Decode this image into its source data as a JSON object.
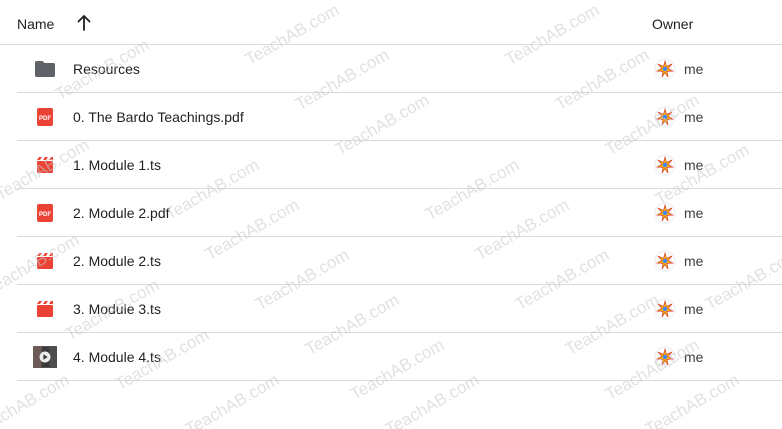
{
  "header": {
    "name_label": "Name",
    "sort_icon": "arrow-up-icon",
    "owner_label": "Owner"
  },
  "rows": [
    {
      "name": "Resources",
      "icon": "folder-icon",
      "owner": "me"
    },
    {
      "name": "0. The Bardo Teachings.pdf",
      "icon": "pdf-icon",
      "owner": "me"
    },
    {
      "name": "1. Module 1.ts",
      "icon": "video-clapper-icon",
      "owner": "me"
    },
    {
      "name": "2. Module 2.pdf",
      "icon": "pdf-icon",
      "owner": "me"
    },
    {
      "name": "2. Module 2.ts",
      "icon": "video-clapper-icon",
      "owner": "me"
    },
    {
      "name": "3. Module 3.ts",
      "icon": "video-clapper-icon",
      "owner": "me"
    },
    {
      "name": "4. Module 4.ts",
      "icon": "video-thumbnail-icon",
      "owner": "me"
    }
  ],
  "watermark": "TeachAB.com",
  "colors": {
    "pdf_red": "#ea4335",
    "folder_gray": "#5f6368",
    "divider": "#dadce0"
  }
}
